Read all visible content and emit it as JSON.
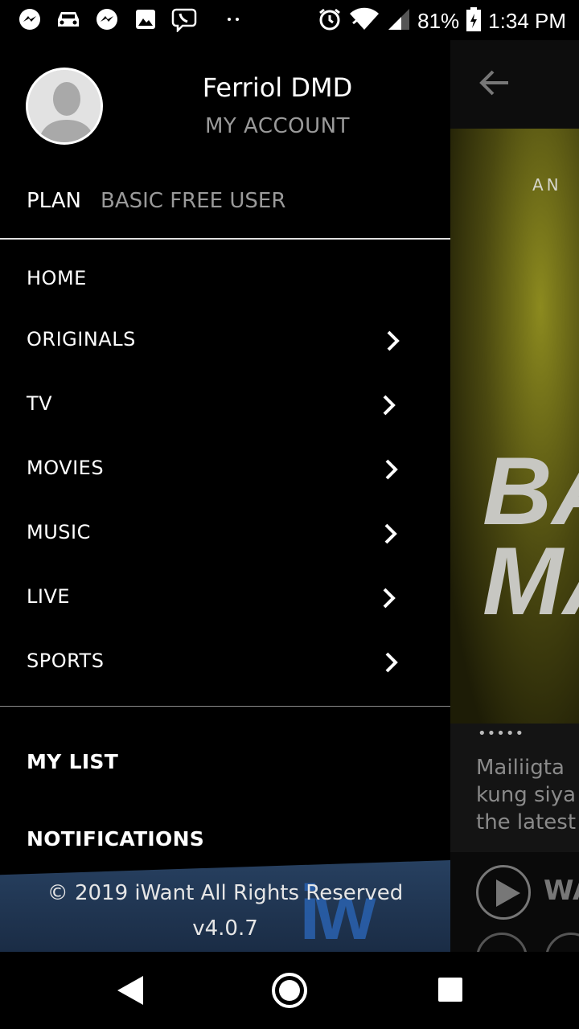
{
  "status_bar": {
    "icons": [
      "messenger-icon",
      "car-icon",
      "messenger-icon",
      "image-icon",
      "viber-icon",
      "dots-icon",
      "alarm-icon",
      "wifi-icon",
      "signal-icon",
      "battery-icon"
    ],
    "battery": "81%",
    "time": "1:34 PM"
  },
  "drawer": {
    "user_name": "Ferriol DMD",
    "my_account": "MY ACCOUNT",
    "plan_label": "PLAN",
    "plan_value": "BASIC FREE USER",
    "menu": [
      {
        "label": "HOME",
        "has_chevron": false
      },
      {
        "label": "ORIGINALS",
        "has_chevron": true
      },
      {
        "label": "TV",
        "has_chevron": true
      },
      {
        "label": "MOVIES",
        "has_chevron": true
      },
      {
        "label": "MUSIC",
        "has_chevron": true
      },
      {
        "label": "LIVE",
        "has_chevron": true
      },
      {
        "label": "SPORTS",
        "has_chevron": true
      }
    ],
    "my_list": "MY LIST",
    "notifications": "NOTIFICATIONS",
    "footer": {
      "copyright": "© 2019 iWant All Rights Reserved",
      "version": "v4.0.7",
      "logo_text": "iw"
    }
  },
  "background": {
    "poster_tag": "AN",
    "poster_title": "BA\nMA",
    "dots": "•••••",
    "description": "Mailiigta\nkung siya\nthe latest",
    "now_playing": "WA"
  },
  "colors": {
    "drawer_bg": "#000000",
    "secondary_text": "#9a9a9a",
    "footer_blue": "#274060",
    "poster_yellow": "#8c8a1f"
  }
}
